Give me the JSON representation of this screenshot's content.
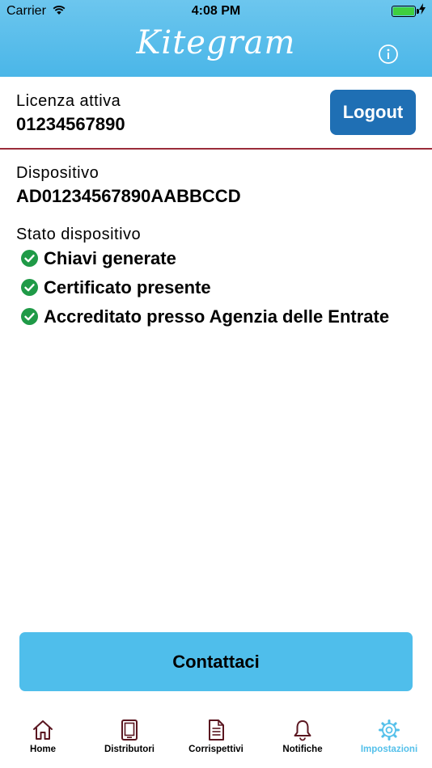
{
  "status_bar": {
    "carrier": "Carrier",
    "time": "4:08 PM"
  },
  "header": {
    "brand": "Kitegram",
    "info_icon": "info-icon"
  },
  "license": {
    "label": "Licenza attiva",
    "number": "01234567890",
    "logout_label": "Logout"
  },
  "device": {
    "label": "Dispositivo",
    "id": "AD01234567890AABBCCD",
    "state_label": "Stato dispositivo",
    "states": [
      {
        "text": "Chiavi generate",
        "icon": "check-circle-icon"
      },
      {
        "text": "Certificato presente",
        "icon": "check-circle-icon"
      },
      {
        "text": "Accreditato presso Agenzia delle Entrate",
        "icon": "check-circle-icon"
      }
    ]
  },
  "contact_button": "Contattaci",
  "tabs": [
    {
      "label": "Home",
      "icon": "home-icon"
    },
    {
      "label": "Distributori",
      "icon": "device-icon"
    },
    {
      "label": "Corrispettivi",
      "icon": "document-icon"
    },
    {
      "label": "Notifiche",
      "icon": "bell-icon"
    },
    {
      "label": "Impostazioni",
      "icon": "gear-icon",
      "active": true
    }
  ],
  "colors": {
    "header": "#4ab6e8",
    "accent": "#54c0ea",
    "logout": "#1f6fb4",
    "check": "#1f9a47",
    "divider": "#9a2b3a",
    "tab_icon": "#5a1620"
  }
}
